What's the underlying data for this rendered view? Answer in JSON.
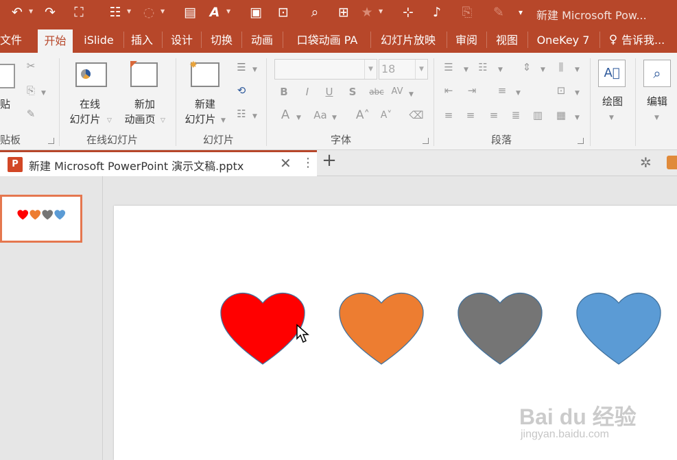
{
  "window": {
    "title": "新建 Microsoft Pow...",
    "accent": "#b7472a"
  },
  "quick_access": [
    "undo-icon",
    "redo-icon",
    "from-beginning-icon",
    "layout-icon",
    "shapes-icon",
    "text-box-icon",
    "font-color-icon",
    "screenshot-icon",
    "record-icon",
    "presenter-icon",
    "onekey-icon",
    "star-icon",
    "slide-size-icon",
    "animation-pane-icon",
    "copy-icon",
    "format-painter-icon",
    "customize-qat-icon"
  ],
  "ribbon_tabs": [
    {
      "label": "文件"
    },
    {
      "label": "开始",
      "active": true
    },
    {
      "label": "iSlide"
    },
    {
      "label": "插入"
    },
    {
      "label": "设计"
    },
    {
      "label": "切换"
    },
    {
      "label": "动画"
    },
    {
      "label": "口袋动画 PA"
    },
    {
      "label": "幻灯片放映"
    },
    {
      "label": "审阅"
    },
    {
      "label": "视图"
    },
    {
      "label": "OneKey 7"
    },
    {
      "label": "告诉我..."
    }
  ],
  "ribbon": {
    "clipboard": {
      "paste_label": "贴",
      "group_label": "贴板"
    },
    "online_slides": {
      "btn1": "在线",
      "btn1b": "幻灯片",
      "btn2": "新加",
      "btn2b": "动画页",
      "group_label": "在线幻灯片"
    },
    "slides": {
      "new_slide": "新建",
      "new_slide_b": "幻灯片",
      "group_label": "幻灯片"
    },
    "font": {
      "font_name": "",
      "font_size": "18",
      "group_label": "字体"
    },
    "paragraph": {
      "group_label": "段落"
    },
    "drawing": {
      "label": "绘图"
    },
    "editing": {
      "label": "编辑"
    }
  },
  "document_tab": {
    "name": "新建 Microsoft PowerPoint 演示文稿.pptx",
    "badge": "P"
  },
  "slide": {
    "hearts": [
      {
        "name": "red",
        "color": "#ff0000"
      },
      {
        "name": "orange",
        "color": "#ed7d31"
      },
      {
        "name": "gray",
        "color": "#757575"
      },
      {
        "name": "blue",
        "color": "#5b9bd5"
      }
    ]
  },
  "watermark": {
    "brand": "Bai du 经验",
    "url": "jingyan.baidu.com"
  }
}
